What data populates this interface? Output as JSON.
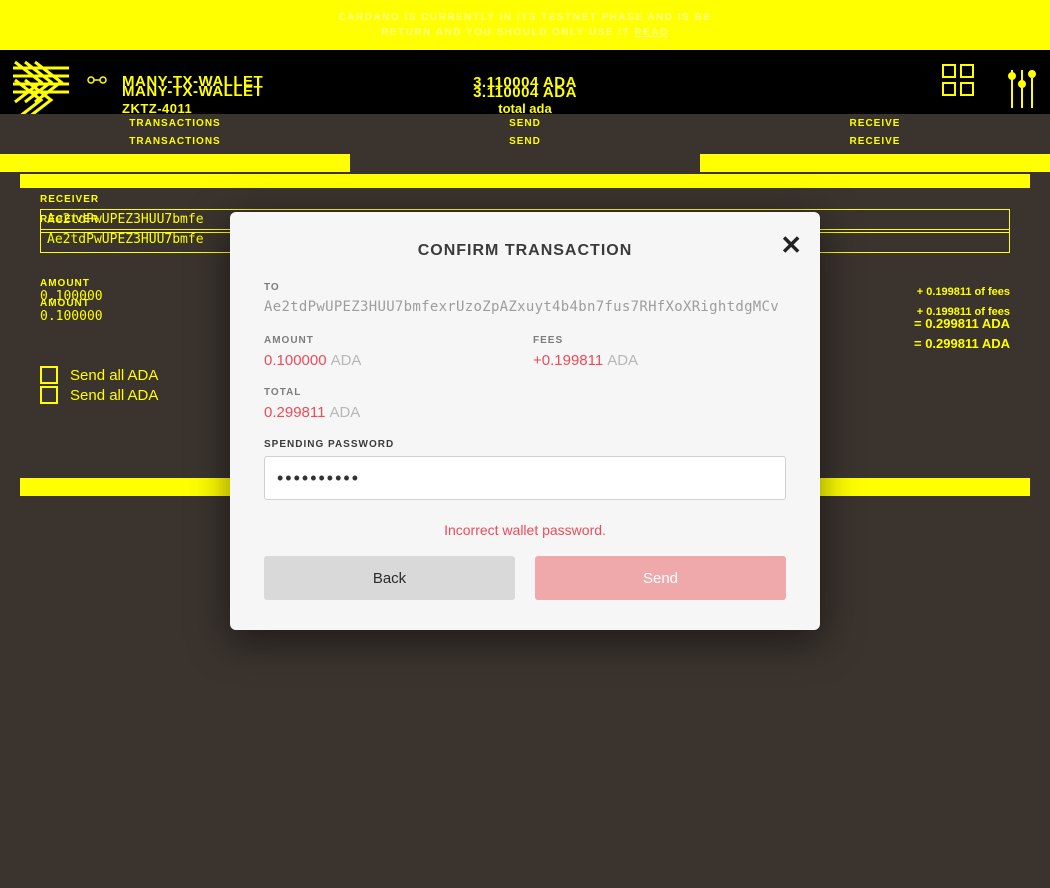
{
  "banner": {
    "line1": "CARDANO IS CURRENTLY IN ITS TESTNET PHASE AND IS BE",
    "line2": "RETURN AND YOU SHOULD ONLY USE IT",
    "link": "READ"
  },
  "header": {
    "wallet_name": "MANY-TX-WALLET",
    "wallet_sub": "ZKTZ-4011",
    "wallet_sub2": "total ada",
    "balance": "3.110004 ADA",
    "balance2": "3.110004 ADA"
  },
  "tabs": {
    "transactions": "TRANSACTIONS",
    "send": "SEND",
    "receive": "RECEIVE"
  },
  "form": {
    "receiver_label": "RECEIVER",
    "receiver_value": "Ae2tdPwUPEZ3HUU7bmfe",
    "amount_label": "AMOUNT",
    "amount_value": "0.100000",
    "fee_note": "+ 0.199811 of fees",
    "total_note": "= 0.299811 ADA",
    "sendall": "Send all ADA"
  },
  "modal": {
    "title": "CONFIRM TRANSACTION",
    "to_label": "TO",
    "to_value": "Ae2tdPwUPEZ3HUU7bmfexrUzoZpAZxuyt4b4bn7fus7RHfXoXRightdgMCv",
    "amount_label": "AMOUNT",
    "amount_value": "0.100000",
    "amount_unit": "ADA",
    "fees_label": "FEES",
    "fees_value": "+0.199811",
    "fees_unit": "ADA",
    "total_label": "TOTAL",
    "total_value": "0.299811",
    "total_unit": "ADA",
    "pw_label": "SPENDING PASSWORD",
    "pw_value": "••••••••••",
    "error": "Incorrect wallet password.",
    "back": "Back",
    "send": "Send"
  }
}
